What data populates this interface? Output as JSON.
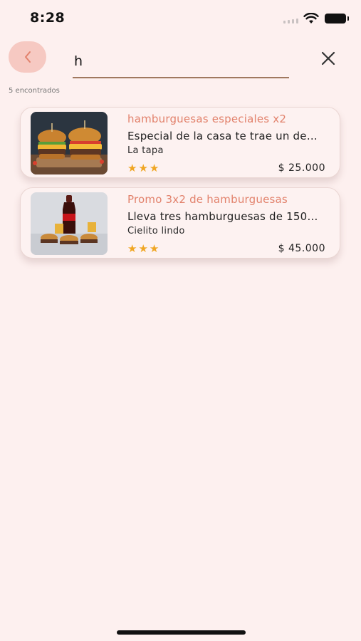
{
  "status_bar": {
    "time": "8:28"
  },
  "search": {
    "query": "h"
  },
  "results_count": "5 encontrados",
  "results": [
    {
      "title": "hamburguesas especiales x2",
      "description": "Especial de la casa te trae un de…",
      "store": "La tapa",
      "rating": "★★★",
      "price": "$ 25.000"
    },
    {
      "title": "Promo 3x2 de hamburguesas",
      "description": "Lleva tres hamburguesas de 150…",
      "store": "Cielito lindo",
      "rating": "★★★",
      "price": "$ 45.000"
    }
  ],
  "icons": {
    "back": "chevron-left-icon",
    "clear": "close-icon",
    "wifi": "wifi-icon",
    "battery": "battery-icon",
    "signal": "cellular-signal-icon"
  },
  "colors": {
    "background": "#fdf0ef",
    "accent": "#e2826c",
    "back_button": "#f6c9c2",
    "star": "#f0a623",
    "underline": "#a0785f"
  }
}
